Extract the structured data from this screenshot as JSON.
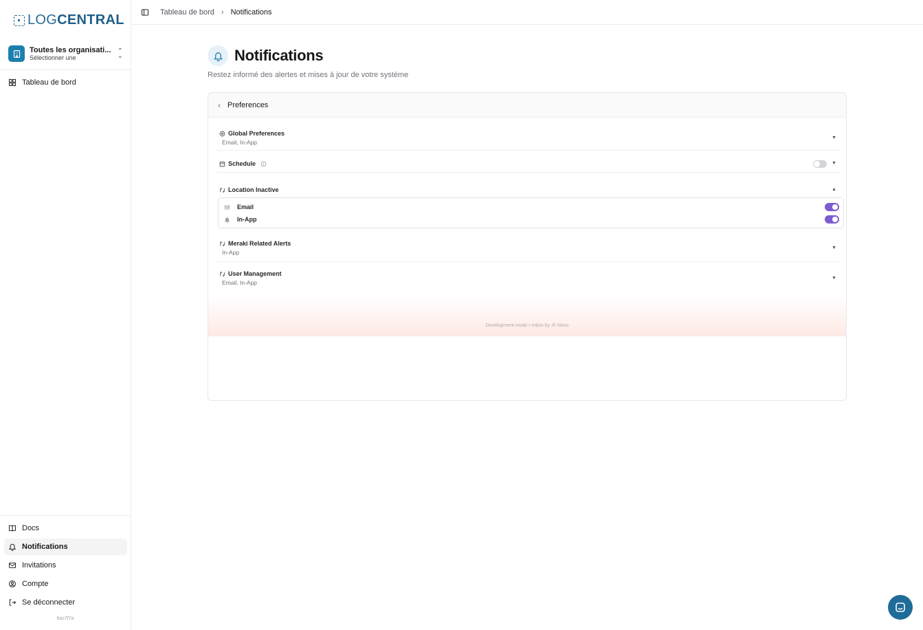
{
  "brand": {
    "prefix": "LOG",
    "suffix": "CENTRAL",
    "color": "#2a6a93"
  },
  "org_switcher": {
    "name": "Toutes les organisati...",
    "subtitle": "Sélectionner une"
  },
  "sidebar": {
    "top_items": [
      {
        "label": "Tableau de bord",
        "icon": "dashboard-icon"
      }
    ],
    "bottom_items": [
      {
        "label": "Docs",
        "icon": "book-icon",
        "active": false
      },
      {
        "label": "Notifications",
        "icon": "bell-icon",
        "active": true
      },
      {
        "label": "Invitations",
        "icon": "mail-icon",
        "active": false
      },
      {
        "label": "Compte",
        "icon": "user-circle-icon",
        "active": false
      },
      {
        "label": "Se déconnecter",
        "icon": "logout-icon",
        "active": false
      }
    ],
    "version": "6ac7f7a"
  },
  "breadcrumb": {
    "parent": "Tableau de bord",
    "separator": "›",
    "current": "Notifications"
  },
  "page": {
    "title": "Notifications",
    "subtitle": "Restez informé des alertes et mises à jour de votre système"
  },
  "inbox": {
    "header": "Preferences",
    "preferences": [
      {
        "title": "Global Preferences",
        "channels": "Email, In-App"
      },
      {
        "title": "Schedule",
        "enabled": false
      },
      {
        "title": "Location Inactive",
        "expanded": true,
        "items": [
          {
            "label": "Email",
            "enabled": true
          },
          {
            "label": "In-App",
            "enabled": true
          }
        ]
      },
      {
        "title": "Meraki Related Alerts",
        "channels": "In-App"
      },
      {
        "title": "User Management",
        "channels": "Email, In-App"
      }
    ],
    "footer": "Development mode • Inbox by ⁂ Novu"
  },
  "colors": {
    "accent": "#7c5ccf",
    "primary": "#1c7fae",
    "chat": "#1f6b99"
  }
}
